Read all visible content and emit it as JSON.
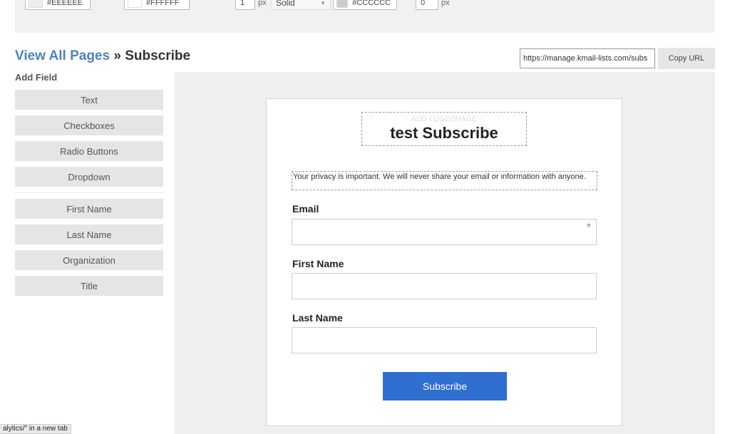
{
  "toolbar": {
    "bg_color": "#EEEEEE",
    "form_color": "#FFFFFF",
    "border_width": "1",
    "border_width_unit": "px",
    "border_style": "Solid",
    "border_color": "#CCCCCC",
    "radius": "0",
    "radius_unit": "px"
  },
  "breadcrumb": {
    "link": "View All Pages",
    "separator": " » ",
    "current": "Subscribe"
  },
  "url": {
    "value": "https://manage.kmail-lists.com/subs",
    "copy_label": "Copy URL"
  },
  "add_field": {
    "title": "Add Field",
    "basic": [
      "Text",
      "Checkboxes",
      "Radio Buttons",
      "Dropdown"
    ],
    "preset": [
      "First Name",
      "Last Name",
      "Organization",
      "Title"
    ]
  },
  "form": {
    "logo_placeholder": "ADD LOGO/IMAGE",
    "title": "test Subscribe",
    "privacy": "Your privacy is important. We will never share your email or information with anyone.",
    "email_label": "Email",
    "required_mark": "*",
    "first_name_label": "First Name",
    "last_name_label": "Last Name",
    "submit_label": "Subscribe"
  },
  "status": "alytics/\" in a new tab",
  "colors": {
    "accent_link": "#4a83bf",
    "submit_button": "#2f6fd0",
    "canvas_bg": "#efefef"
  }
}
